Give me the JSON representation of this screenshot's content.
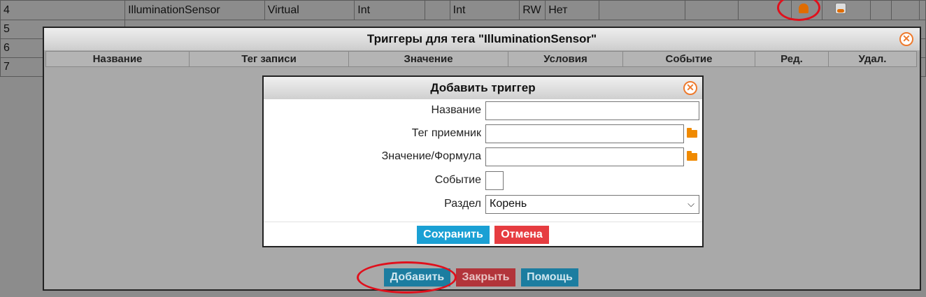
{
  "background_table": {
    "rows": [
      {
        "num": "4",
        "name": "IlluminationSensor",
        "kind": "Virtual",
        "type1": "Int",
        "type2": "Int",
        "access": "RW",
        "flag": "Нет"
      },
      {
        "num": "5",
        "name": "",
        "kind": "",
        "type1": "",
        "type2": "",
        "access": "",
        "flag": ""
      },
      {
        "num": "6",
        "name": "",
        "kind": "",
        "type1": "",
        "type2": "",
        "access": "",
        "flag": ""
      },
      {
        "num": "7",
        "name": "",
        "kind": "",
        "type1": "",
        "type2": "",
        "access": "",
        "flag": ""
      }
    ]
  },
  "triggers_dialog": {
    "title": "Триггеры для тега \"IlluminationSensor\"",
    "columns": [
      "Название",
      "Тег записи",
      "Значение",
      "Условия",
      "Событие",
      "Ред.",
      "Удал."
    ],
    "add_label": "Добавить",
    "close_label": "Закрыть",
    "help_label": "Помощь"
  },
  "add_trigger_dialog": {
    "title": "Добавить триггер",
    "fields": {
      "name_label": "Название",
      "name_value": "",
      "target_tag_label": "Тег приемник",
      "target_tag_value": "",
      "value_formula_label": "Значение/Формула",
      "value_formula_value": "",
      "event_label": "Событие",
      "event_value": "",
      "section_label": "Раздел",
      "section_value": "Корень"
    },
    "save_label": "Сохранить",
    "cancel_label": "Отмена"
  },
  "colors": {
    "save": "#1aa0d4",
    "cancel": "#e63c40",
    "add": "#1c7da0",
    "close": "#b2343a",
    "icon_accent": "#f08a00",
    "annotation": "#e0101c"
  }
}
